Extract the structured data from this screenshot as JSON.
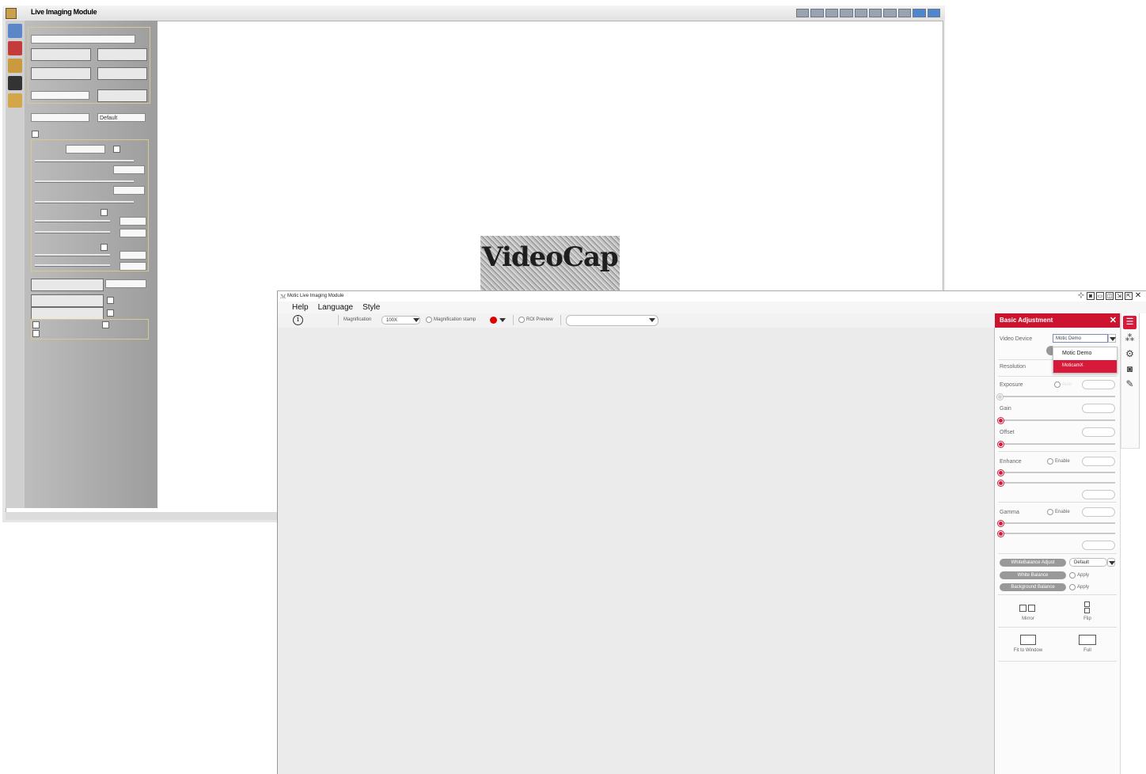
{
  "back_window": {
    "title": "Live Imaging Module",
    "videocap_text": "VideoCap",
    "sidebar_combo_value": "Default"
  },
  "front_window": {
    "title": "Motic Live Imaging Module",
    "menu": [
      "Help",
      "Language",
      "Style"
    ],
    "toolbar": {
      "magnification_label": "Magnification",
      "magnification_value": "100X",
      "magnification_stamp_label": "Magnification stamp",
      "stamp_color": "#e00000",
      "roi_preview_label": "ROI Preview"
    },
    "panel": {
      "title": "Basic Adjustment",
      "video_device_label": "Video Device",
      "video_device_value": "Motic Demo",
      "device_options": [
        "Motic Demo",
        "MoticamX"
      ],
      "resolution_label": "Resolution",
      "exposure_label": "Exposure",
      "exposure_auto_label": "Auto",
      "gain_label": "Gain",
      "offset_label": "Offset",
      "enhance_label": "Enhance",
      "enhance_enable_label": "Enable",
      "gamma_label": "Gamma",
      "gamma_enable_label": "Enable",
      "wb_adjust_label": "WhiteBalance Adjust",
      "wb_adjust_value": "Default",
      "white_balance_label": "White Balance",
      "white_balance_apply": "Apply",
      "background_balance_label": "Background Balance",
      "background_balance_apply": "Apply",
      "mirror_label": "Mirror",
      "flip_label": "Flip",
      "fit_to_window_label": "Fit to Window",
      "full_label": "Full"
    },
    "accent_color": "#d71a3a"
  }
}
